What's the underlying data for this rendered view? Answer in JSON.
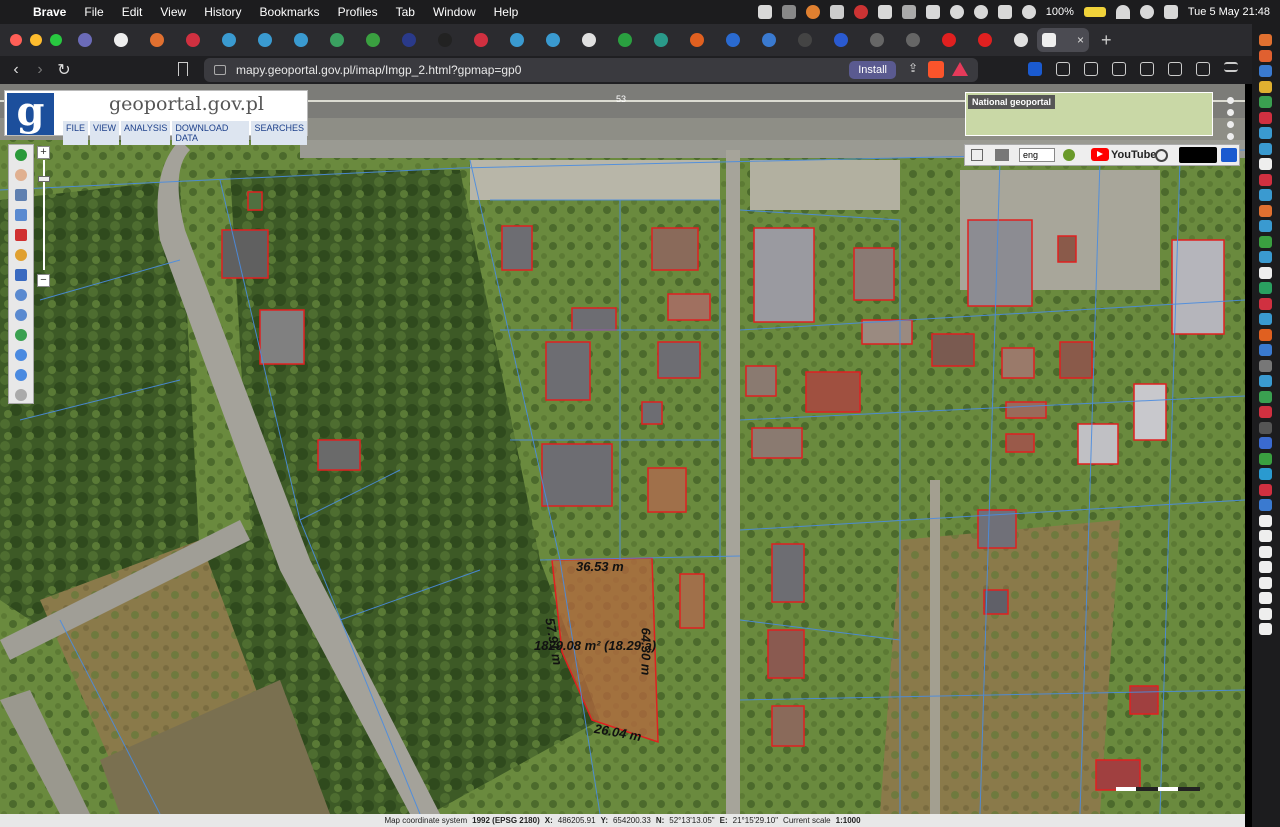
{
  "menubar": {
    "app": "Brave",
    "items": [
      "File",
      "Edit",
      "View",
      "History",
      "Bookmarks",
      "Profiles",
      "Tab",
      "Window",
      "Help"
    ],
    "battery": "100%",
    "datetime": "Tue 5 May  21:48"
  },
  "browser": {
    "url": "mapy.geoportal.gov.pl/imap/Imgp_2.html?gpmap=gp0",
    "install_label": "Install",
    "new_tab": "+",
    "close_tab": "×"
  },
  "geoportal": {
    "logo_letter": "g",
    "title": "geoportal.gov.pl",
    "menu": [
      "FILE",
      "VIEW",
      "ANALYSIS",
      "DOWNLOAD DATA",
      "SEARCHES"
    ],
    "national_label": "National geoportal",
    "language": "eng",
    "youtube": "YouTube",
    "road_number": "53"
  },
  "parcel": {
    "top": "36.53 m",
    "left": "57.91 m",
    "right": "64.30 m",
    "bottom": "26.04 m",
    "area": "1829.08 m² (18.29 a)"
  },
  "status": {
    "system_label": "Map coordinate system",
    "system": "1992 (EPSG 2180)",
    "x": "486205.91",
    "y": "654200.33",
    "n": "52°13'13.05\"",
    "e": "21°15'29.10\"",
    "scale_label": "Current scale",
    "scale": "1:1000"
  },
  "colors": {
    "accent": "#1c4f9c",
    "parcel_outline": "#e02020",
    "building_outline": "#e02020",
    "cadastral_lines": "#4a8ce0"
  }
}
